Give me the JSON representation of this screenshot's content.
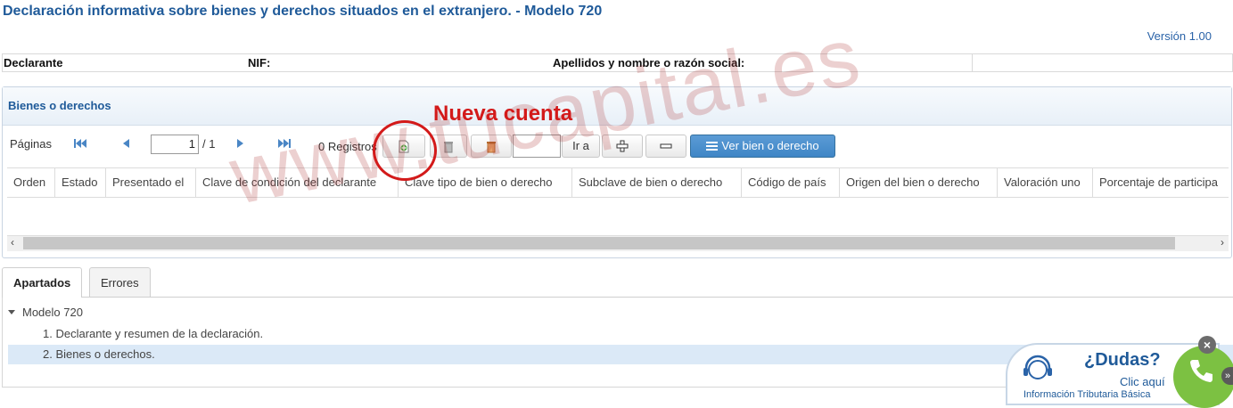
{
  "header": {
    "title": "Declaración informativa sobre bienes y derechos situados en el extranjero. - Modelo 720",
    "version": "Versión 1.00"
  },
  "declarante_bar": {
    "declarante": "Declarante",
    "nif": "NIF:",
    "apellidos": "Apellidos y nombre o razón social:"
  },
  "panel": {
    "title": "Bienes o derechos",
    "toolbar": {
      "paginas_label": "Páginas",
      "page_value": "1",
      "page_total": "/ 1",
      "registros": "0 Registros",
      "goto_value": "",
      "goto_label": "Ir a",
      "ver_bien_label": "Ver bien o derecho"
    },
    "columns": [
      "Orden",
      "Estado",
      "Presentado el",
      "Clave de condición del declarante",
      "Clave tipo de bien o derecho",
      "Subclave de bien o derecho",
      "Código de país",
      "Origen del bien o derecho",
      "Valoración uno",
      "Porcentaje de participa"
    ]
  },
  "tabs": [
    "Apartados",
    "Errores"
  ],
  "tree": {
    "root": "Modelo 720",
    "items": [
      "1. Declarante y resumen de la declaración.",
      "2. Bienes o derechos."
    ]
  },
  "annotation": "Nueva cuenta",
  "watermark": "www.tucapital.es",
  "help_widget": {
    "title": "¿Dudas?",
    "link": "Clic aquí",
    "subtitle": "Información Tributaria Básica"
  },
  "colors": {
    "title_blue": "#1f5a99",
    "annotation_red": "#d31a1a",
    "primary_button": "#3f86c6",
    "phone_green": "#7cc142"
  }
}
